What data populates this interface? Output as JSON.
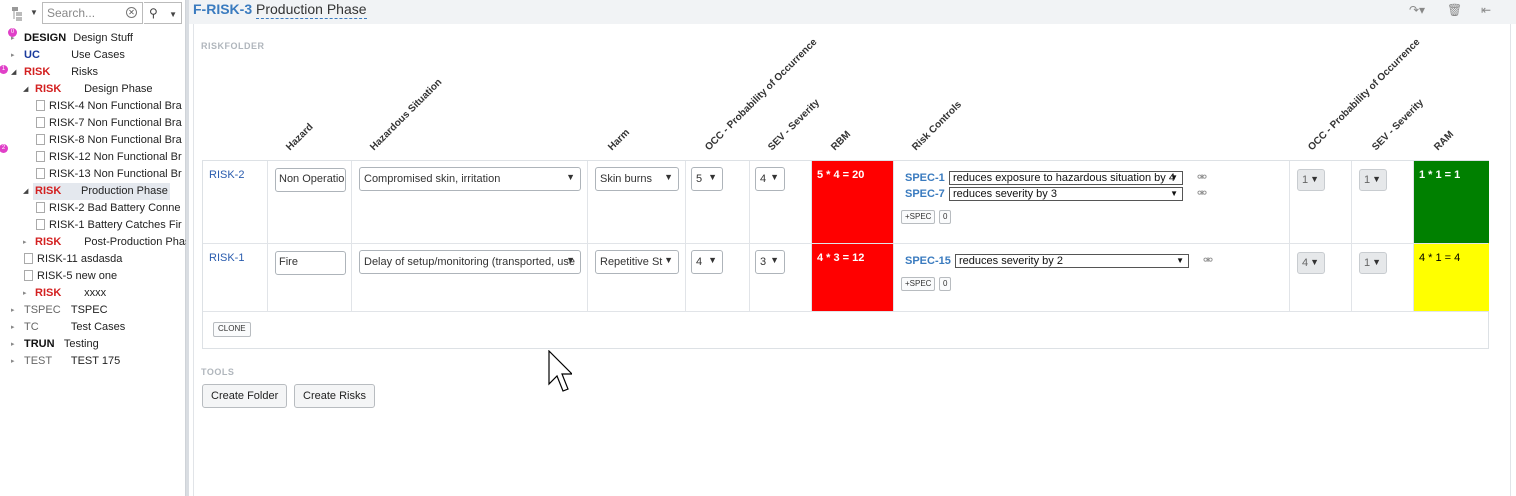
{
  "tree": {
    "search_placeholder": "Search...",
    "badges": [
      "0",
      "1",
      "2"
    ],
    "items": [
      {
        "code": "DESIGN",
        "label": "Design Stuff"
      },
      {
        "code": "UC",
        "label": "Use Cases"
      },
      {
        "code": "RISK",
        "label": "Risks"
      },
      {
        "code": "RISK",
        "label": "Design Phase"
      },
      {
        "code": "RISK-4",
        "label": "Non Functional Bra"
      },
      {
        "code": "RISK-7",
        "label": "Non Functional Bra"
      },
      {
        "code": "RISK-8",
        "label": "Non Functional Bra"
      },
      {
        "code": "RISK-12",
        "label": "Non Functional Br"
      },
      {
        "code": "RISK-13",
        "label": "Non Functional Br"
      },
      {
        "code": "RISK",
        "label": "Production Phase"
      },
      {
        "code": "RISK-2",
        "label": "Bad Battery Conne"
      },
      {
        "code": "RISK-1",
        "label": "Battery Catches Fir"
      },
      {
        "code": "RISK",
        "label": "Post-Production Phas"
      },
      {
        "code": "RISK-11",
        "label": "asdasda"
      },
      {
        "code": "RISK-5",
        "label": "new one"
      },
      {
        "code": "RISK",
        "label": "xxxx"
      },
      {
        "code": "TSPEC",
        "label": "TSPEC"
      },
      {
        "code": "TC",
        "label": "Test Cases"
      },
      {
        "code": "TRUN",
        "label": "Testing"
      },
      {
        "code": "TEST",
        "label": "TEST 175"
      }
    ]
  },
  "header": {
    "id": "F-RISK-3",
    "title": "Production Phase",
    "icons": [
      "share-icon",
      "trash-icon",
      "collapse-icon"
    ]
  },
  "riskfolder_label": "RISKFOLDER",
  "columns": {
    "hazard": "Hazard",
    "hazardous_situation": "Hazardous Situation",
    "harm": "Harm",
    "occ": "OCC - Probability of Occurrence",
    "sev": "SEV - Severity",
    "rbm": "RBM",
    "risk_controls": "Risk Controls",
    "occ2": "OCC - Probability of Occurrence",
    "sev2": "SEV - Severity",
    "ram": "RAM"
  },
  "rows": [
    {
      "id": "RISK-2",
      "hazard": "Non Operational",
      "situation": "Compromised skin, irritation",
      "harm": "Skin burns",
      "occ": "5",
      "sev": "4",
      "rbm": "5 * 4 = 20",
      "rbm_color": "#ff0000",
      "controls": [
        {
          "spec": "SPEC-1",
          "text": "reduces exposure to hazardous situation by 4"
        },
        {
          "spec": "SPEC-7",
          "text": "reduces severity by 3"
        }
      ],
      "add_spec": "+SPEC",
      "count": "0",
      "occ2": "1",
      "sev2": "1",
      "ram": "1 * 1 = 1",
      "ram_color": "#008000"
    },
    {
      "id": "RISK-1",
      "hazard": "Fire",
      "situation": "Delay of setup/monitoring (transported, use",
      "harm": "Repetitive St",
      "occ": "4",
      "sev": "3",
      "rbm": "4 * 3 = 12",
      "rbm_color": "#ff0000",
      "controls": [
        {
          "spec": "SPEC-15",
          "text": "reduces severity by 2"
        }
      ],
      "add_spec": "+SPEC",
      "count": "0",
      "occ2": "4",
      "sev2": "1",
      "ram": "4 * 1 = 4",
      "ram_color": "#ffff00"
    }
  ],
  "clone_label": "CLONE",
  "tools_label": "TOOLS",
  "buttons": {
    "create_folder": "Create Folder",
    "create_risks": "Create Risks"
  }
}
